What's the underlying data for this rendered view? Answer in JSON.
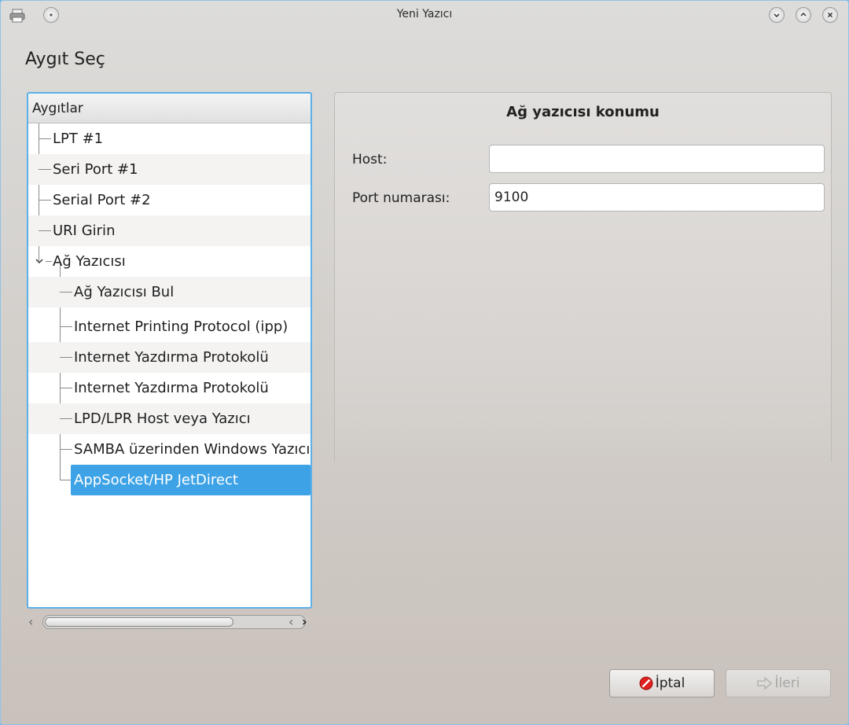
{
  "window": {
    "title": "Yeni Yazıcı"
  },
  "page": {
    "heading": "Aygıt Seç"
  },
  "tree": {
    "header": "Aygıtlar",
    "items": [
      {
        "label": "LPT #1"
      },
      {
        "label": "Seri Port #1"
      },
      {
        "label": "Serial Port #2"
      },
      {
        "label": "URI Girin"
      },
      {
        "label": "Ağ Yazıcısı",
        "expanded": true
      },
      {
        "label": "Ağ Yazıcısı Bul"
      },
      {
        "label": "Internet Printing Protocol (ipp)"
      },
      {
        "label": "Internet Yazdırma Protokolü"
      },
      {
        "label": "Internet Yazdırma Protokolü"
      },
      {
        "label": "LPD/LPR Host veya Yazıcı"
      },
      {
        "label": "SAMBA üzerinden Windows Yazıcı"
      },
      {
        "label": "AppSocket/HP JetDirect",
        "selected": true
      }
    ]
  },
  "form": {
    "title": "Ağ yazıcısı konumu",
    "host_label": "Host:",
    "host_value": "",
    "port_label": "Port numarası:",
    "port_value": "9100"
  },
  "buttons": {
    "cancel": "İptal",
    "next": "İleri"
  },
  "colors": {
    "selection": "#3da3e6",
    "focus_border": "#5cb0e8",
    "cancel_icon": "#e02020"
  }
}
